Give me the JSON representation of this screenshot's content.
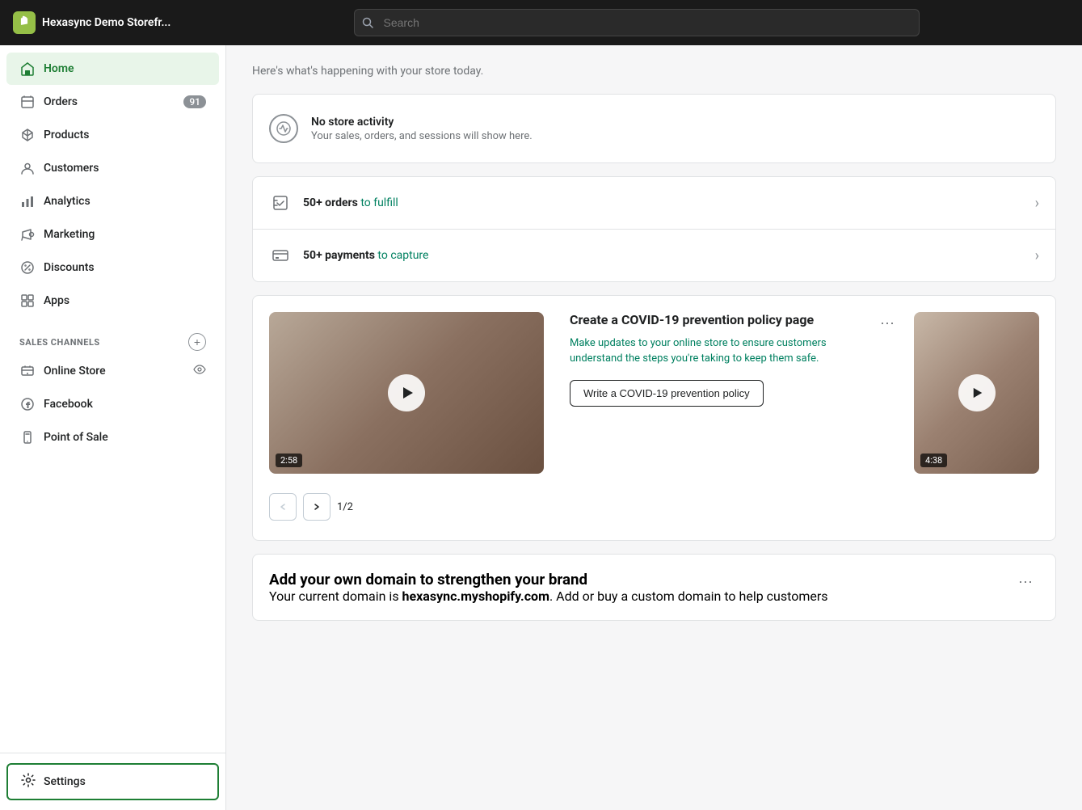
{
  "topbar": {
    "store_name": "Hexasync Demo Storefr...",
    "search_placeholder": "Search"
  },
  "sidebar": {
    "nav_items": [
      {
        "id": "home",
        "label": "Home",
        "icon": "home-icon",
        "active": true,
        "badge": null
      },
      {
        "id": "orders",
        "label": "Orders",
        "icon": "orders-icon",
        "active": false,
        "badge": "91"
      },
      {
        "id": "products",
        "label": "Products",
        "icon": "products-icon",
        "active": false,
        "badge": null
      },
      {
        "id": "customers",
        "label": "Customers",
        "icon": "customers-icon",
        "active": false,
        "badge": null
      },
      {
        "id": "analytics",
        "label": "Analytics",
        "icon": "analytics-icon",
        "active": false,
        "badge": null
      },
      {
        "id": "marketing",
        "label": "Marketing",
        "icon": "marketing-icon",
        "active": false,
        "badge": null
      },
      {
        "id": "discounts",
        "label": "Discounts",
        "icon": "discounts-icon",
        "active": false,
        "badge": null
      },
      {
        "id": "apps",
        "label": "Apps",
        "icon": "apps-icon",
        "active": false,
        "badge": null
      }
    ],
    "sales_channels_header": "SALES CHANNELS",
    "sales_channels": [
      {
        "id": "online-store",
        "label": "Online Store",
        "icon": "online-store-icon",
        "has_eye": true
      },
      {
        "id": "facebook",
        "label": "Facebook",
        "icon": "facebook-icon",
        "has_eye": false
      },
      {
        "id": "point-of-sale",
        "label": "Point of Sale",
        "icon": "pos-icon",
        "has_eye": false
      }
    ],
    "settings_label": "Settings"
  },
  "main": {
    "subtitle": "Here's what's happening with your store today.",
    "no_activity": {
      "title": "No store activity",
      "description": "Your sales, orders, and sessions will show here."
    },
    "action_items": [
      {
        "id": "orders-fulfill",
        "bold": "50+ orders",
        "text": " to fulfill"
      },
      {
        "id": "payments-capture",
        "bold": "50+ payments",
        "text": " to capture"
      }
    ],
    "video_card": {
      "title": "Create a COVID-19 prevention policy page",
      "description": "Make updates to your online store to ensure customers understand the steps you're taking to keep them safe.",
      "cta_label": "Write a COVID-19 prevention policy",
      "duration1": "2:58",
      "duration2": "4:38",
      "pagination": "1/2"
    },
    "domain_card": {
      "title": "Add your own domain to strengthen your brand",
      "description_prefix": "Your current domain is ",
      "domain": "hexasync.myshopify.com",
      "description_suffix": ". Add or buy a custom domain to help customers"
    }
  }
}
